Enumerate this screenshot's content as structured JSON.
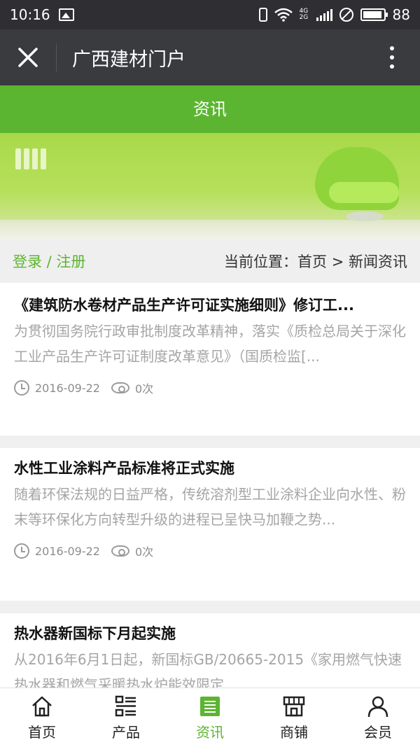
{
  "status_bar": {
    "time": "10:16",
    "network": "4G 2G",
    "battery": "88"
  },
  "header": {
    "title": "广西建材门户"
  },
  "section_title": "资讯",
  "breadcrumb": {
    "login": "登录 / 注册",
    "location": "当前位置：首页 > 新闻资讯"
  },
  "articles": [
    {
      "title": "《建筑防水卷材产品生产许可证实施细则》修订工...",
      "desc": "为贯彻国务院行政审批制度改革精神，落实《质检总局关于深化工业产品生产许可证制度改革意见》（国质检监[...",
      "date": "2016-09-22",
      "views": "0次"
    },
    {
      "title": "水性工业涂料产品标准将正式实施",
      "desc": "随着环保法规的日益严格，传统溶剂型工业涂料企业向水性、粉末等环保化方向转型升级的进程已呈快马加鞭之势...",
      "date": "2016-09-22",
      "views": "0次"
    },
    {
      "title": "热水器新国标下月起实施",
      "desc": "从2016年6月1日起，新国标GB/20665-2015《家用燃气快速热水器和燃气采暖热水炉能效限定"
    }
  ],
  "bottom_nav": {
    "items": [
      {
        "label": "首页",
        "icon": "home-icon"
      },
      {
        "label": "产品",
        "icon": "list-icon"
      },
      {
        "label": "资讯",
        "icon": "news-icon"
      },
      {
        "label": "商铺",
        "icon": "store-icon"
      },
      {
        "label": "会员",
        "icon": "user-icon"
      }
    ],
    "active": "资讯"
  },
  "colors": {
    "accent": "#5cb531",
    "header_bg": "#3a3b3f"
  }
}
